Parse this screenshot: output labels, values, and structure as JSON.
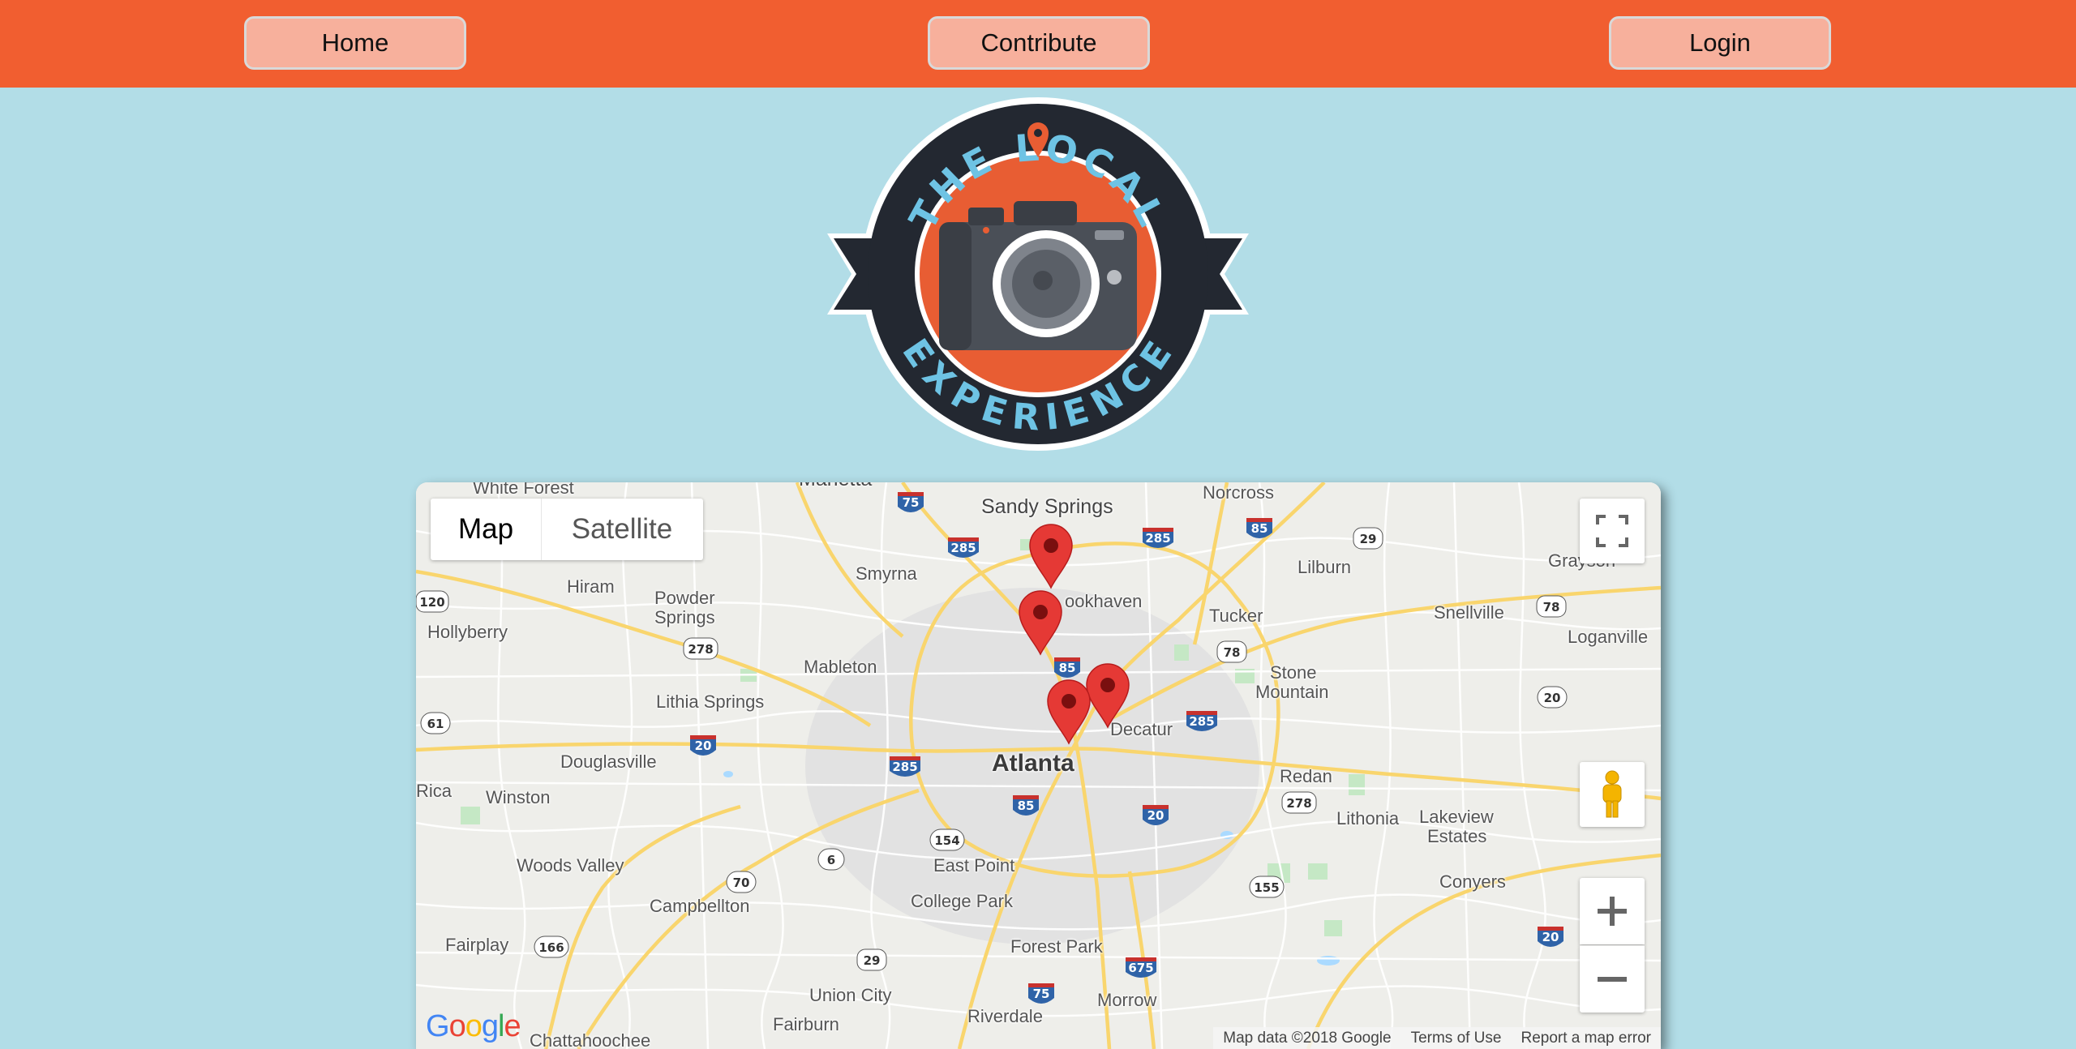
{
  "nav": {
    "home": "Home",
    "contribute": "Contribute",
    "login": "Login"
  },
  "logo": {
    "top_text": "THE LOCAL",
    "bottom_text": "EXPERIENCE"
  },
  "map": {
    "type_control": {
      "map": "Map",
      "satellite": "Satellite"
    },
    "attribution": {
      "data": "Map data ©2018 Google",
      "terms": "Terms of Use",
      "report": "Report a map error"
    },
    "brand": "Google",
    "places": {
      "white_forest": "White Forest",
      "marietta": "Marietta",
      "sandy_springs": "Sandy Springs",
      "norcross": "Norcross",
      "smyrna": "Smyrna",
      "hiram": "Hiram",
      "powder_springs_1": "Powder",
      "powder_springs_2": "Springs",
      "brookhaven": "ookhaven",
      "lilburn": "Lilburn",
      "grayson": "Grayson",
      "hollyberry": "Hollyberry",
      "tucker": "Tucker",
      "snellville": "Snellville",
      "loganville": "Loganville",
      "mableton": "Mableton",
      "stone_mountain_1": "Stone",
      "stone_mountain_2": "Mountain",
      "lithia_springs": "Lithia Springs",
      "decatur": "Decatur",
      "douglasville": "Douglasville",
      "atlanta": "Atlanta",
      "redan": "Redan",
      "rica": "Rica",
      "winston": "Winston",
      "lithonia": "Lithonia",
      "lakeview_1": "Lakeview",
      "lakeview_2": "Estates",
      "woods_valley": "Woods Valley",
      "east_point": "East Point",
      "campbellton": "Campbellton",
      "conyers": "Conyers",
      "college_park": "College Park",
      "fairplay": "Fairplay",
      "forest_park": "Forest Park",
      "union_city": "Union City",
      "riverdale": "Riverdale",
      "morrow": "Morrow",
      "fairburn": "Fairburn",
      "chattahoochee": "Chattahoochee"
    },
    "shields": {
      "i75a": "75",
      "i285a": "285",
      "i285b": "285",
      "i85a": "85",
      "us29": "29",
      "us78": "78",
      "us120": "120",
      "us278a": "278",
      "i85b": "85",
      "us78b": "78",
      "i285c": "285",
      "s20": "20",
      "s61": "61",
      "i20a": "20",
      "i285d": "285",
      "i85c": "85",
      "i20b": "20",
      "us278b": "278",
      "s154": "154",
      "s6": "6",
      "s70": "70",
      "s155": "155",
      "s166": "166",
      "us29b": "29",
      "i75b": "75",
      "i675": "675",
      "i20c": "20"
    },
    "marker_color": "#e53935"
  }
}
